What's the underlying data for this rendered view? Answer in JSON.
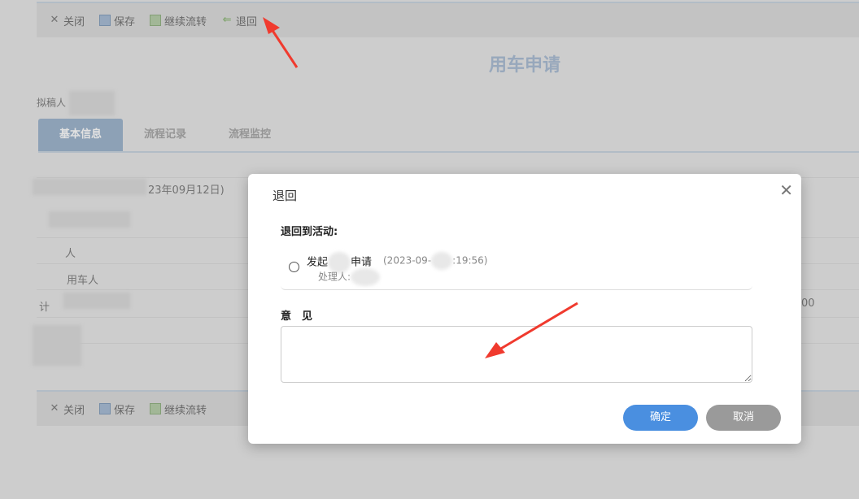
{
  "toolbar": {
    "close_label": "关闭",
    "save_label": "保存",
    "continue_label": "继续流转",
    "return_label": "退回"
  },
  "form": {
    "title": "用车申请",
    "drafter_label": "拟稿人",
    "tabs": [
      {
        "label": "基本信息",
        "active": true
      },
      {
        "label": "流程记录",
        "active": false
      },
      {
        "label": "流程监控",
        "active": false
      }
    ],
    "bg_date_fragment": "23年09月12日)",
    "bg_row_person": "人",
    "bg_row_car_user": "用车人",
    "bg_row_ji": "计",
    "bg_right_fragment": "00"
  },
  "dialog": {
    "title": "退回",
    "return_to_label": "退回到活动:",
    "activity": {
      "name_prefix": "发起",
      "name_suffix": "申请",
      "time_prefix": "(2023-09-",
      "time_suffix": ":19:56)",
      "handler_label": "处理人:"
    },
    "opinion_label": "意　见",
    "opinion_value": "",
    "confirm_label": "确定",
    "cancel_label": "取消"
  },
  "colors": {
    "accent": "#4a8fe0",
    "tab_active": "#7f9dbd",
    "title": "#8fa8c6",
    "arrow": "#f03a2e"
  },
  "icons": [
    "close-icon",
    "save-icon",
    "continue-icon",
    "return-arrow-icon",
    "dialog-close-icon"
  ]
}
